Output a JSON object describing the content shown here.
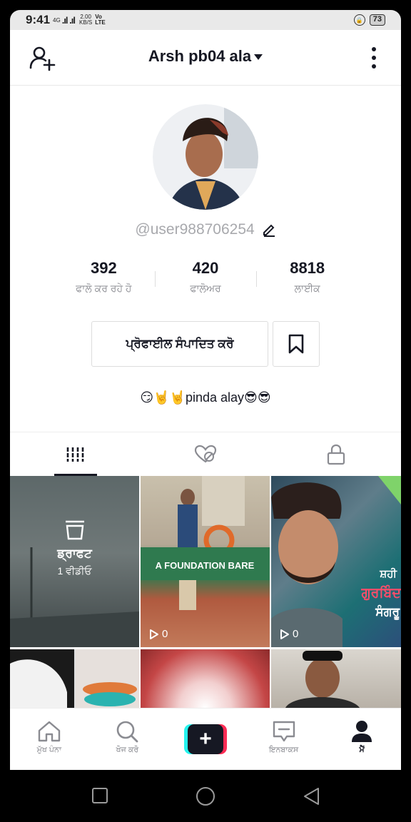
{
  "status_bar": {
    "time": "9:41",
    "network": "4G",
    "signal": ".ıl .ıl",
    "speed_value": "2.00",
    "speed_unit": "KB/S",
    "volte_top": "Vo",
    "volte_bottom": "LTE",
    "battery": "73"
  },
  "header": {
    "username": "Arsh pb04 ala",
    "icons": {
      "left": "add-user-icon",
      "right": "more-vertical-icon",
      "dropdown": "caret-down-icon"
    }
  },
  "profile": {
    "handle": "@user988706254",
    "stats": [
      {
        "value": "392",
        "label": "ਫਾਲੋ ਕਰ ਰਹੇ ਹੋ"
      },
      {
        "value": "420",
        "label": "ਫਾਲੋਅਰ"
      },
      {
        "value": "8818",
        "label": "ਲਾਈਕ"
      }
    ],
    "edit_button": "ਪ੍ਰੋਫਾਈਲ ਸੰਪਾਦਿਤ ਕਰੋ",
    "bio": "😏🤘🤘pinda alay😎😎"
  },
  "tabs": [
    {
      "icon": "grid-icon",
      "active": true
    },
    {
      "icon": "liked-hidden-icon",
      "active": false
    },
    {
      "icon": "lock-icon",
      "active": false
    }
  ],
  "videos": {
    "draft": {
      "title": "ਡ੍ਰਾਫਟ",
      "count": "1 ਵੀਡੀਓ"
    },
    "items": [
      {
        "views": "0",
        "caption_lines": [
          "A FOUNDATION BARE"
        ]
      },
      {
        "views": "0",
        "caption_lines": [
          "ਸ਼ਹੀ",
          "ਗੁਰਬਿੰਦ",
          "ਸੰਗਰੂ"
        ]
      }
    ]
  },
  "bottom_nav": [
    {
      "label": "ਮੁੱਖ ਪੰਨਾ",
      "icon": "home-icon"
    },
    {
      "label": "ਖੋਜ ਕਰੋ",
      "icon": "search-icon"
    },
    {
      "label": "",
      "icon": "create-plus-icon",
      "glyph": "+"
    },
    {
      "label": "ਇਨਬਾਕਸ",
      "icon": "inbox-icon"
    },
    {
      "label": "ਮੈਂ",
      "icon": "profile-icon",
      "active": true
    }
  ],
  "colors": {
    "accent_pink": "#fe2c55",
    "accent_cyan": "#25f4ee",
    "text_dark": "#161823",
    "text_grey": "#8a8b91"
  }
}
